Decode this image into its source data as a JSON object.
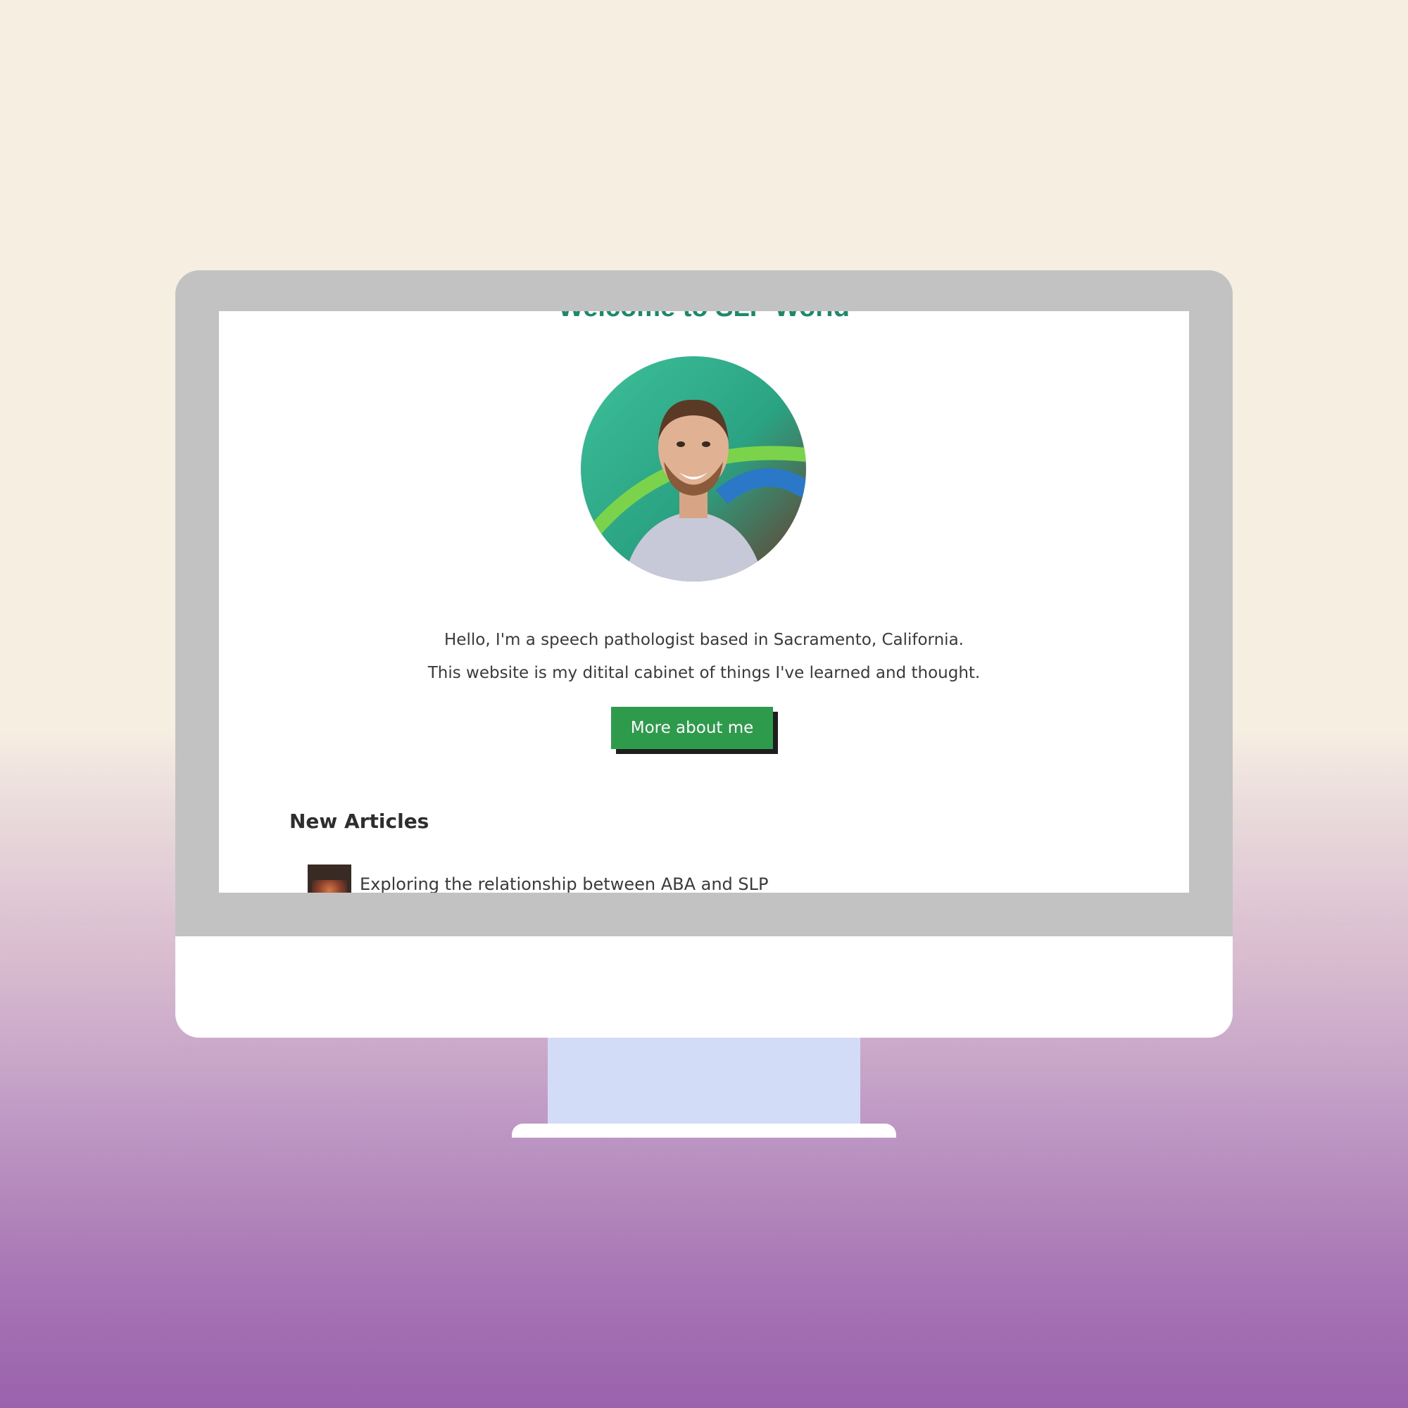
{
  "page": {
    "welcome_title": "Welcome to SLP World",
    "intro_line1": "Hello, I'm a speech pathologist based in Sacramento, California.",
    "intro_line2": "This website is my ditital cabinet of things I've learned and thought.",
    "cta_label": "More about me",
    "articles_heading": "New Articles",
    "articles": [
      {
        "title": "Exploring the relationship between ABA and SLP"
      }
    ]
  },
  "colors": {
    "accent_green": "#2e9a4b",
    "title_teal": "#1c8a6a",
    "bezel": "#c2c2c2",
    "stand": "#d3dcf7"
  }
}
